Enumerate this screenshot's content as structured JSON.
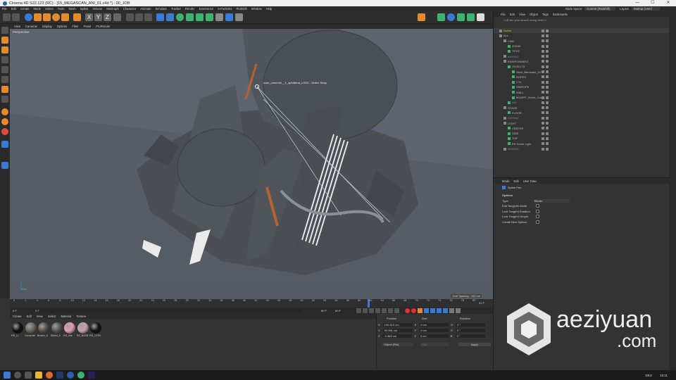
{
  "window": {
    "title": "Cinema 4D S22.123 (RC) - [15_MEGASCAN_ANI_01.c4d *] - 00_JOB",
    "min": "—",
    "max": "☐",
    "close": "✕"
  },
  "menu": [
    "File",
    "Edit",
    "Create",
    "Mode",
    "Select",
    "Tools",
    "Mesh",
    "Spline",
    "Volume",
    "MoGraph",
    "Character",
    "Animate",
    "Simulate",
    "Tracker",
    "Render",
    "Extensions",
    "X-Particles",
    "Redshift",
    "Window",
    "Help"
  ],
  "node_space": {
    "label": "Node Space:",
    "value": "Current (Redshift)"
  },
  "layout": {
    "label": "Layout:",
    "value": "Startup (User)"
  },
  "viewport": {
    "menu": [
      "View",
      "Cameras",
      "Display",
      "Options",
      "Filter",
      "Panel",
      "ProRender"
    ],
    "label": "Perspective",
    "snap_tooltip": "scan_concrete__1_uphdbrna_LOD0 - Vertex Snap",
    "grid_spacing": "Grid Spacing : 100 cm",
    "colors": {
      "sky": "#5a6069",
      "ground": "#565c65",
      "mesh": "#4a4d54",
      "accent": "#b5622f"
    }
  },
  "timeline": {
    "ticks": [
      "0",
      "2",
      "4",
      "6",
      "8",
      "10",
      "12",
      "14",
      "16",
      "18",
      "20",
      "22",
      "24",
      "26",
      "28",
      "30",
      "32",
      "34",
      "36",
      "38",
      "40",
      "42",
      "44",
      "46",
      "48",
      "50",
      "52",
      "54",
      "56",
      "58",
      "60",
      "62",
      "64",
      "66",
      "68",
      "70",
      "72",
      "74",
      "76",
      "78",
      "80"
    ],
    "current": "31 F",
    "start": "0 F",
    "start2": "0 F",
    "end": "80 F",
    "end2": "80 F"
  },
  "materials": {
    "menu": [
      "Create",
      "Edit",
      "View",
      "Select",
      "Material",
      "Texture"
    ],
    "items": [
      {
        "name": "RS_Li",
        "color": "#111"
      },
      {
        "name": "Concrete",
        "color": "#6a6560"
      },
      {
        "name": "Brown_0",
        "color": "#5a4e44"
      },
      {
        "name": "Street_0",
        "color": "#555"
      },
      {
        "name": "RS_Ma",
        "color": "#e39ab0"
      },
      {
        "name": "RS_BASE",
        "color": "#c8a0a8"
      },
      {
        "name": "RS_CON",
        "color": "#111"
      }
    ]
  },
  "coordinates": {
    "headers": [
      "Position",
      "Size",
      "Rotation"
    ],
    "rows": [
      {
        "axis": "X",
        "pos": "100.513 cm",
        "size": "0 cm",
        "rlabel": "H",
        "rot": "0 °"
      },
      {
        "axis": "Y",
        "pos": "92.961 cm",
        "size": "0 cm",
        "rlabel": "P",
        "rot": "0 °"
      },
      {
        "axis": "Z",
        "pos": "-1.883 cm",
        "size": "0 cm",
        "rlabel": "B",
        "rot": "0 °"
      }
    ],
    "mode": "Object (Rel)",
    "size_mode": "Size",
    "apply": "Apply"
  },
  "object_manager": {
    "menu": [
      "File",
      "Edit",
      "View",
      "Object",
      "Tags",
      "Bookmarks"
    ],
    "search": "<<Enter your search string here>>",
    "rows": [
      {
        "name": "Spline",
        "color": "#e8b33c",
        "indent": 0
      },
      {
        "name": "ALL",
        "color": "#bbb",
        "indent": 0
      },
      {
        "name": "CAM",
        "color": "#bbb",
        "indent": 1
      },
      {
        "name": "ZOOM",
        "color": "#bbb",
        "indent": 2
      },
      {
        "name": "TITLE",
        "color": "#bbb",
        "indent": 2
      },
      {
        "name": "//////////////",
        "color": "#9a86c8",
        "indent": 1
      },
      {
        "name": "ENVIRONMENT",
        "color": "#bbb",
        "indent": 1
      },
      {
        "name": "OBJECTS",
        "color": "#bbb",
        "indent": 2
      },
      {
        "name": "Steel_Barricade_01",
        "color": "#bbb",
        "indent": 3
      },
      {
        "name": "ROPES",
        "color": "#bbb",
        "indent": 3
      },
      {
        "name": "CYL",
        "color": "#bbb",
        "indent": 3
      },
      {
        "name": "SIMROPE",
        "color": "#bbb",
        "indent": 3
      },
      {
        "name": "WALL",
        "color": "#bbb",
        "indent": 3
      },
      {
        "name": "MGHPF_Street_Curbs",
        "color": "#bbb",
        "indent": 3
      },
      {
        "name": "//////",
        "color": "#9a86c8",
        "indent": 2
      },
      {
        "name": "STAGE",
        "color": "#bbb",
        "indent": 1
      },
      {
        "name": "FLOOR",
        "color": "#bbb",
        "indent": 2
      },
      {
        "name": "//////////////",
        "color": "#9a86c8",
        "indent": 1
      },
      {
        "name": "LIGHT",
        "color": "#bbb",
        "indent": 1
      },
      {
        "name": "CENTER",
        "color": "#bbb",
        "indent": 2
      },
      {
        "name": "SIDE",
        "color": "#bbb",
        "indent": 2
      },
      {
        "name": "TOP",
        "color": "#bbb",
        "indent": 2
      },
      {
        "name": "RS Dome Light",
        "color": "#bbb",
        "indent": 2
      },
      {
        "name": "//////////////",
        "color": "#9a86c8",
        "indent": 1
      }
    ]
  },
  "attributes": {
    "menu": [
      "Mode",
      "Edit",
      "User Data"
    ],
    "object": "Spline Pen",
    "section": "Options",
    "type_label": "Type",
    "type_value": "Bezier",
    "options": [
      "Edit Tangents Mode",
      "Lock Tangent Rotation",
      "Lock Tangent Length",
      "Create New Splines"
    ]
  },
  "watermark": {
    "brand": "aeziyuan",
    "tld": ".com"
  },
  "taskbar": {
    "lang": "DEU",
    "time": "15:11"
  }
}
